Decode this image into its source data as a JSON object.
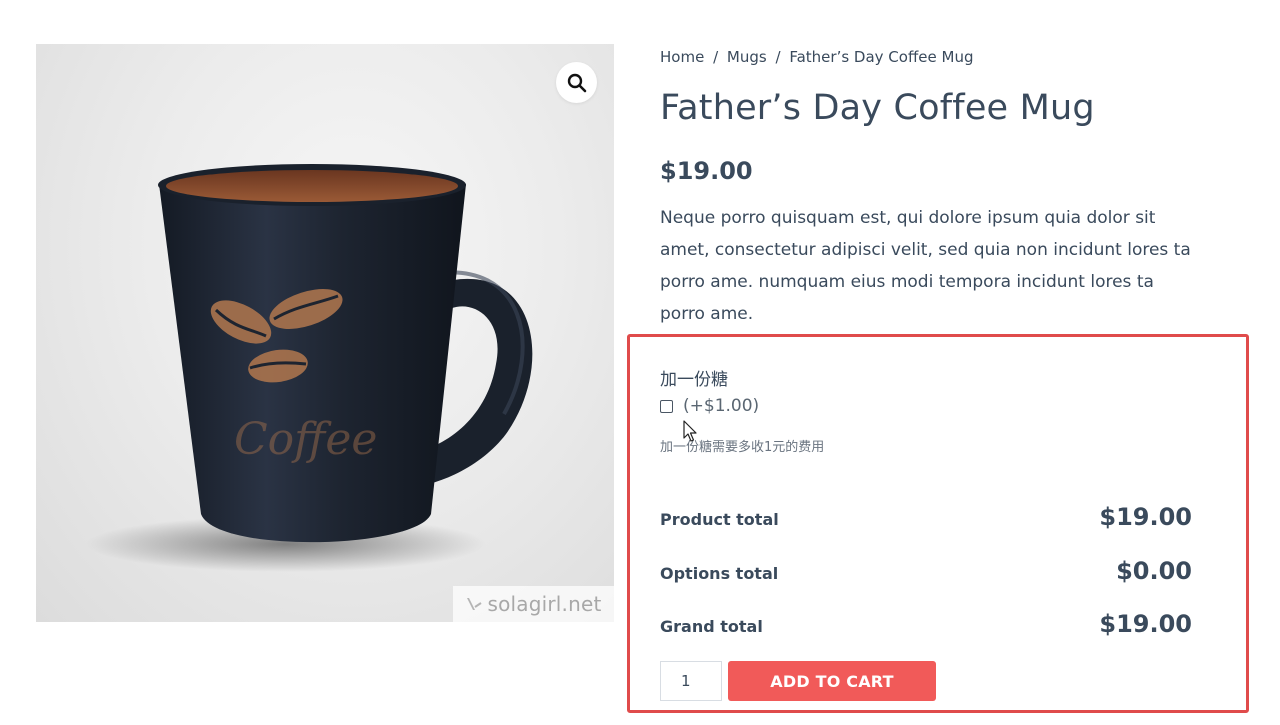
{
  "gallery": {
    "image_alt": "Father’s Day Coffee Mug",
    "mug_text": "Coffee",
    "zoom_icon": "magnifier-icon",
    "watermark": "solagirl.net"
  },
  "breadcrumb": {
    "home": "Home",
    "separator": "/",
    "category": "Mugs",
    "current": "Father’s Day Coffee Mug"
  },
  "product": {
    "title": "Father’s Day Coffee Mug",
    "price": "$19.00",
    "description": "Neque porro quisquam est, qui dolore ipsum quia dolor sit amet, consectetur adipisci velit, sed quia non incidunt lores ta porro ame. numquam eius modi tempora incidunt lores ta porro ame."
  },
  "options": {
    "label": "加一份糖",
    "checkbox_checked": false,
    "price_text": "(+$1.00)",
    "description": "加一份糖需要多收1元的费用"
  },
  "totals": {
    "product_total_label": "Product total",
    "product_total_value": "$19.00",
    "options_total_label": "Options total",
    "options_total_value": "$0.00",
    "grand_total_label": "Grand total",
    "grand_total_value": "$19.00"
  },
  "cart": {
    "quantity": "1",
    "button_label": "ADD TO CART"
  },
  "colors": {
    "text": "#3a4a5c",
    "accent_button": "#f15a59",
    "highlight_border": "#e04b4b",
    "mug_body": "#1f2633",
    "mug_interior": "#8a4a2a"
  }
}
